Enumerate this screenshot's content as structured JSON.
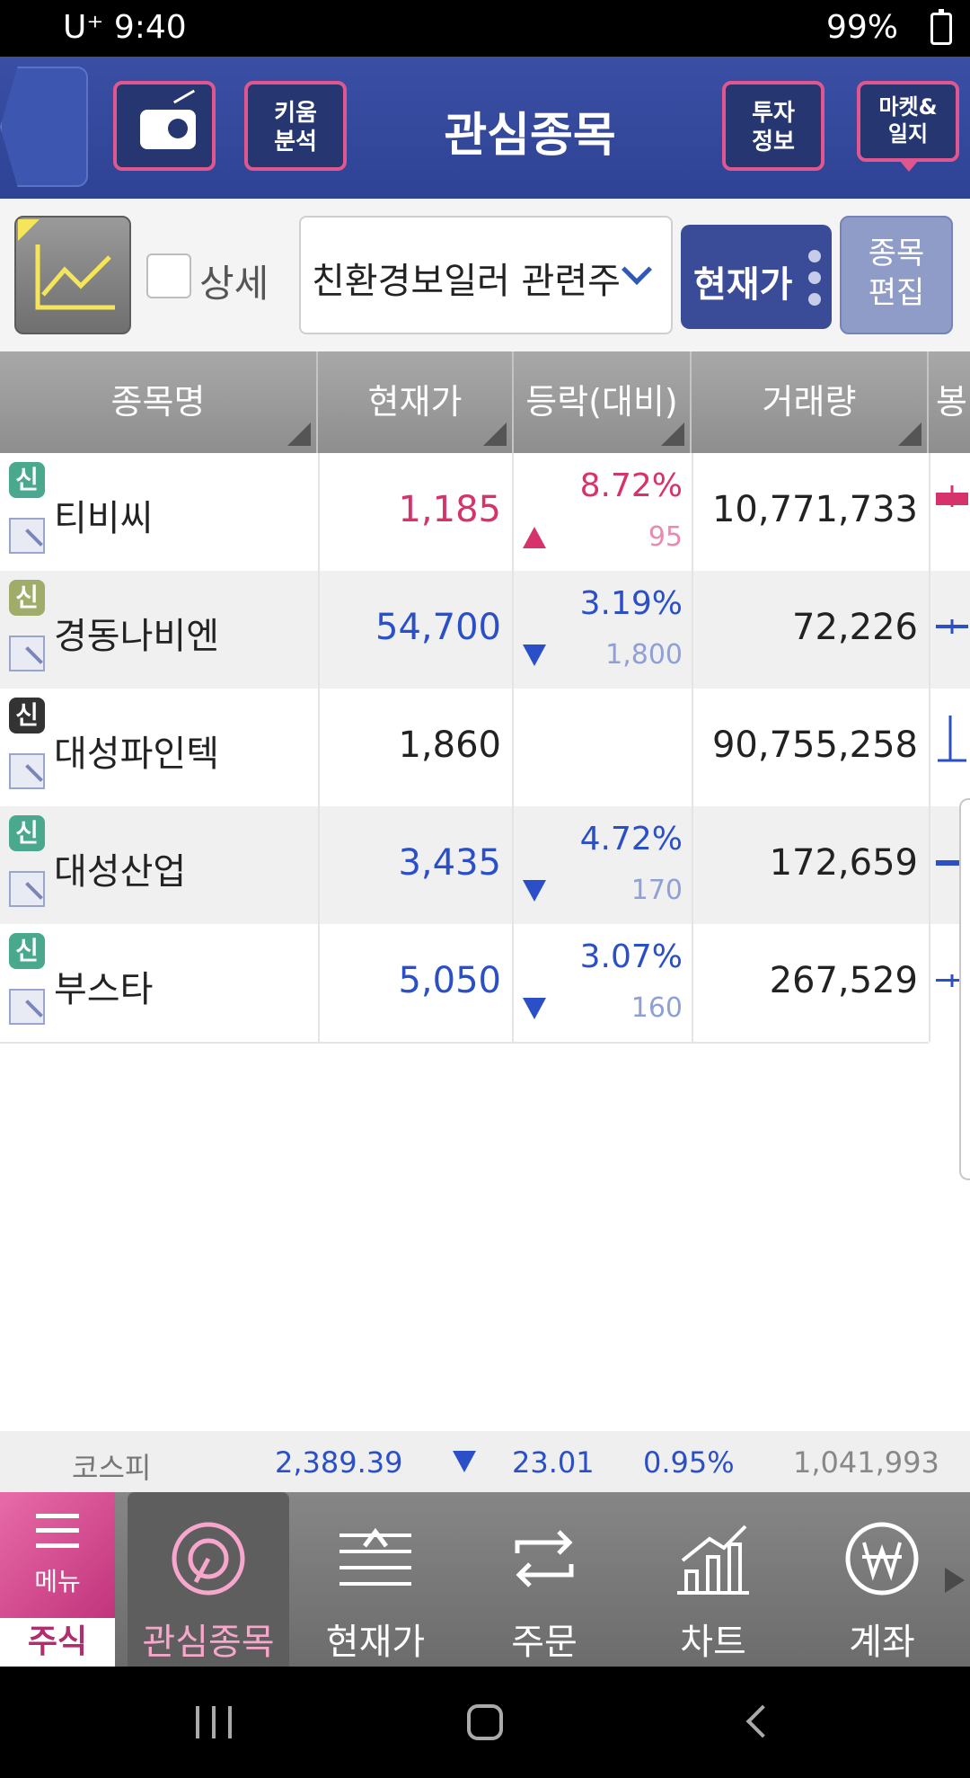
{
  "status_bar": {
    "carrier": "U⁺",
    "time": "9:40",
    "battery": "99%"
  },
  "header": {
    "title": "관심종목",
    "kiwoom_label_1": "키움",
    "kiwoom_label_2": "분석",
    "invest_label_1": "투자",
    "invest_label_2": "정보",
    "market_label_1": "마켓&",
    "market_label_2": "일지"
  },
  "toolbar": {
    "detail_label": "상세",
    "group_value": "친환경보일러 관련주",
    "price_button": "현재가",
    "edit_label_1": "종목",
    "edit_label_2": "편집"
  },
  "table": {
    "columns": [
      "종목명",
      "현재가",
      "등락(대비)",
      "거래량",
      "봉"
    ],
    "badge_text": "신",
    "rows": [
      {
        "name": "티비씨",
        "price": "1,185",
        "change_pct": "8.72%",
        "change_amt": "95",
        "direction": "up",
        "volume": "10,771,733",
        "badge_color": "#4aa88e",
        "price_color": "#d6336c",
        "sub_color": "#e98bb0"
      },
      {
        "name": "경동나비엔",
        "price": "54,700",
        "change_pct": "3.19%",
        "change_amt": "1,800",
        "direction": "down",
        "volume": "72,226",
        "badge_color": "#a0ad6a",
        "price_color": "#2b4fc7",
        "sub_color": "#8fa0d8"
      },
      {
        "name": "대성파인텍",
        "price": "1,860",
        "change_pct": "",
        "change_amt": "",
        "direction": "flat",
        "volume": "90,755,258",
        "badge_color": "#333333",
        "price_color": "#222222",
        "sub_color": "#888888"
      },
      {
        "name": "대성산업",
        "price": "3,435",
        "change_pct": "4.72%",
        "change_amt": "170",
        "direction": "down",
        "volume": "172,659",
        "badge_color": "#4aa88e",
        "price_color": "#2b4fc7",
        "sub_color": "#8fa0d8"
      },
      {
        "name": "부스타",
        "price": "5,050",
        "change_pct": "3.07%",
        "change_amt": "160",
        "direction": "down",
        "volume": "267,529",
        "badge_color": "#4aa88e",
        "price_color": "#2b4fc7",
        "sub_color": "#8fa0d8"
      }
    ]
  },
  "ticker": {
    "index_name": "코스피",
    "index_value": "2,389.39",
    "change": "23.01",
    "change_pct": "0.95%",
    "volume": "1,041,993"
  },
  "bottom_nav": {
    "menu_label": "메뉴",
    "market_tab": "주식",
    "items": [
      "관심종목",
      "현재가",
      "주문",
      "차트",
      "계좌"
    ]
  },
  "colors": {
    "header_bg": "#2f4395",
    "accent_pink": "#e0578f",
    "up": "#d6336c",
    "down": "#2b4fc7"
  }
}
